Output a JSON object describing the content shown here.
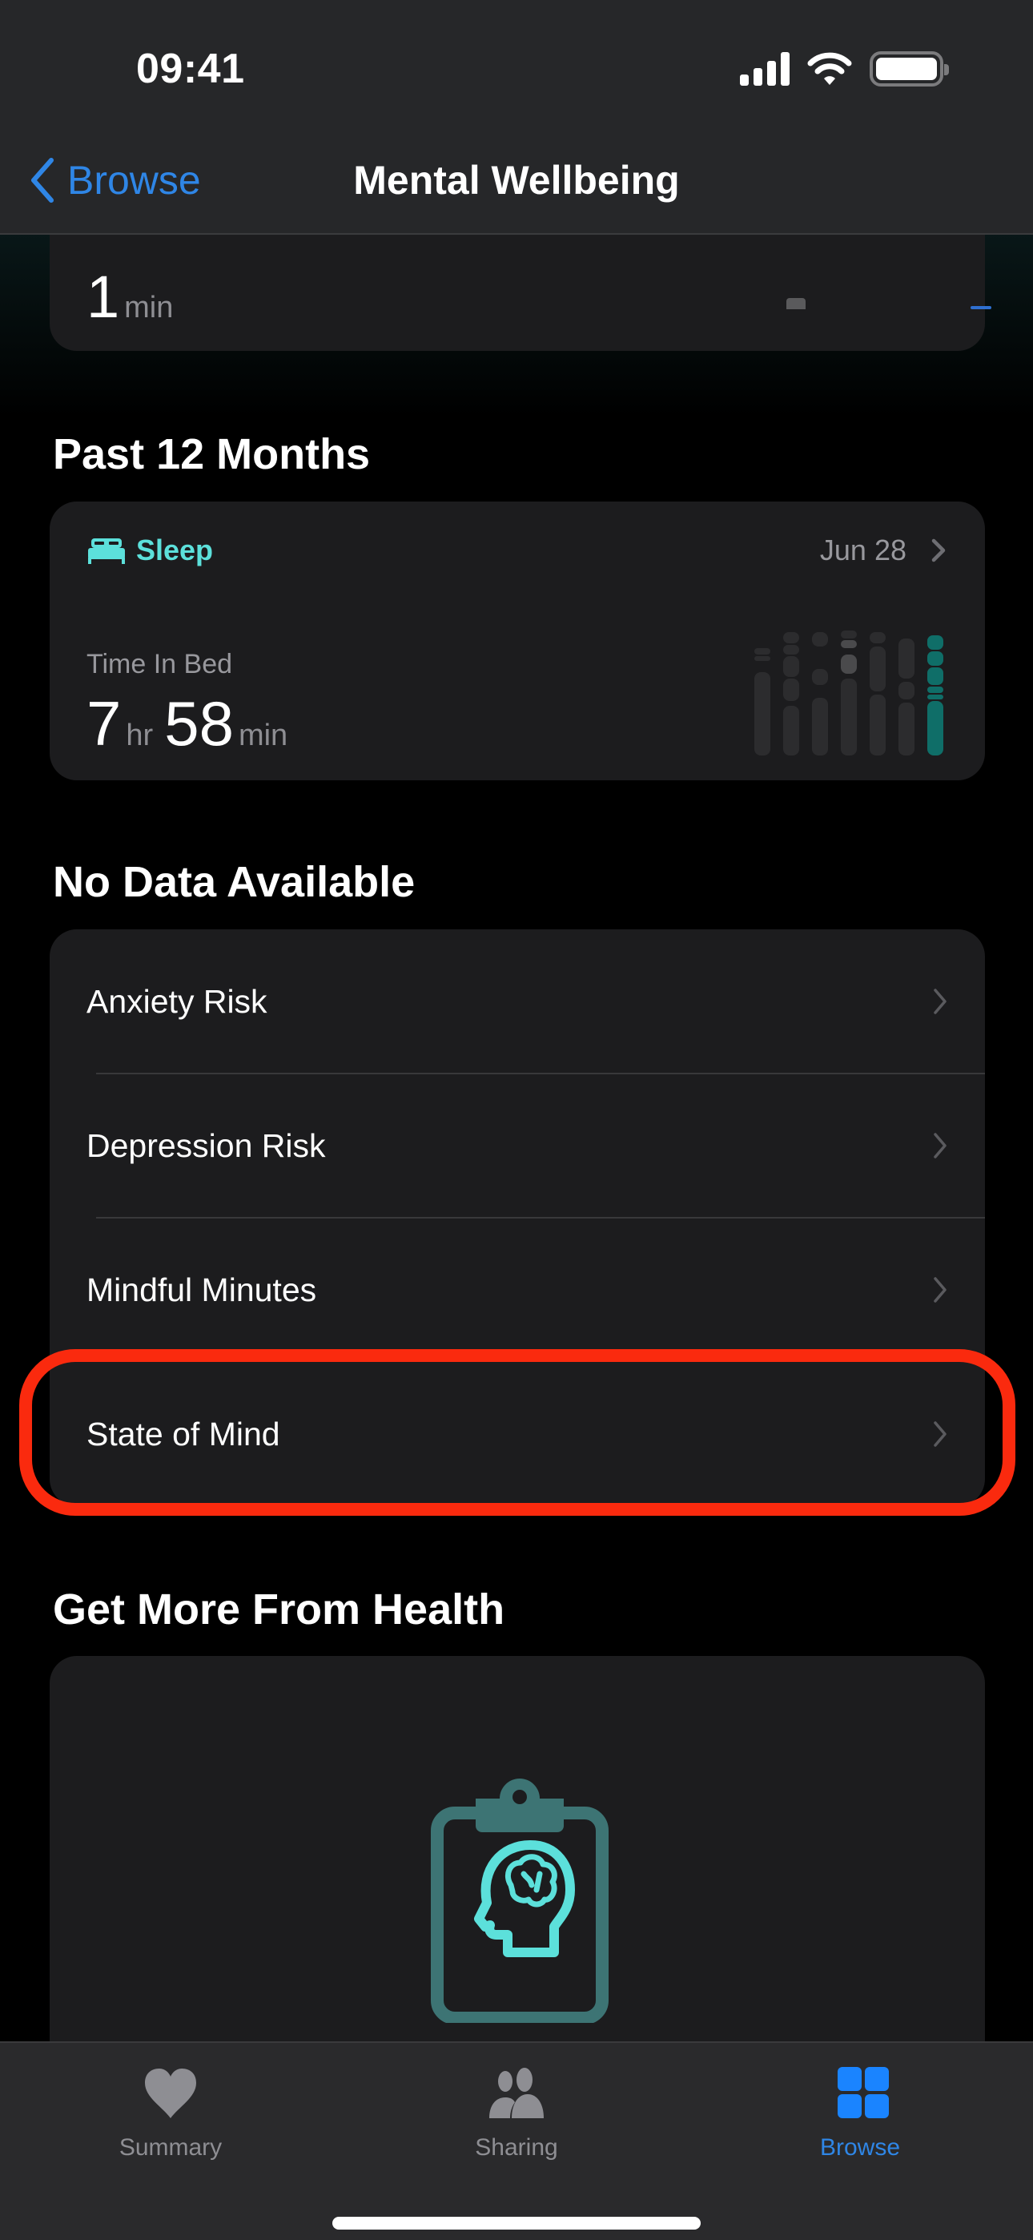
{
  "status_bar": {
    "time": "09:41"
  },
  "nav": {
    "back_label": "Browse",
    "title": "Mental Wellbeing"
  },
  "top_card": {
    "value": "1",
    "unit": "min"
  },
  "past_12_months": {
    "section_title": "Past 12 Months",
    "sleep_card": {
      "category": "Sleep",
      "date": "Jun 28",
      "metric_label": "Time In Bed",
      "hours": "7",
      "hours_unit": "hr",
      "minutes": "58",
      "minutes_unit": "min",
      "accent_color": "#5ce0db"
    }
  },
  "no_data": {
    "section_title": "No Data Available",
    "items": [
      {
        "label": "Anxiety Risk"
      },
      {
        "label": "Depression Risk"
      },
      {
        "label": "Mindful Minutes"
      },
      {
        "label": "State of Mind",
        "highlighted": true
      }
    ]
  },
  "get_more": {
    "section_title": "Get More From Health",
    "icon": "clipboard-brain-icon"
  },
  "tab_bar": {
    "tabs": [
      {
        "label": "Summary",
        "icon": "heart-icon",
        "active": false
      },
      {
        "label": "Sharing",
        "icon": "people-icon",
        "active": false
      },
      {
        "label": "Browse",
        "icon": "grid-icon",
        "active": true
      }
    ]
  },
  "colors": {
    "accent_blue": "#2f86e6",
    "sleep_teal": "#5ce0db",
    "highlight_red": "#fa2a0e"
  }
}
